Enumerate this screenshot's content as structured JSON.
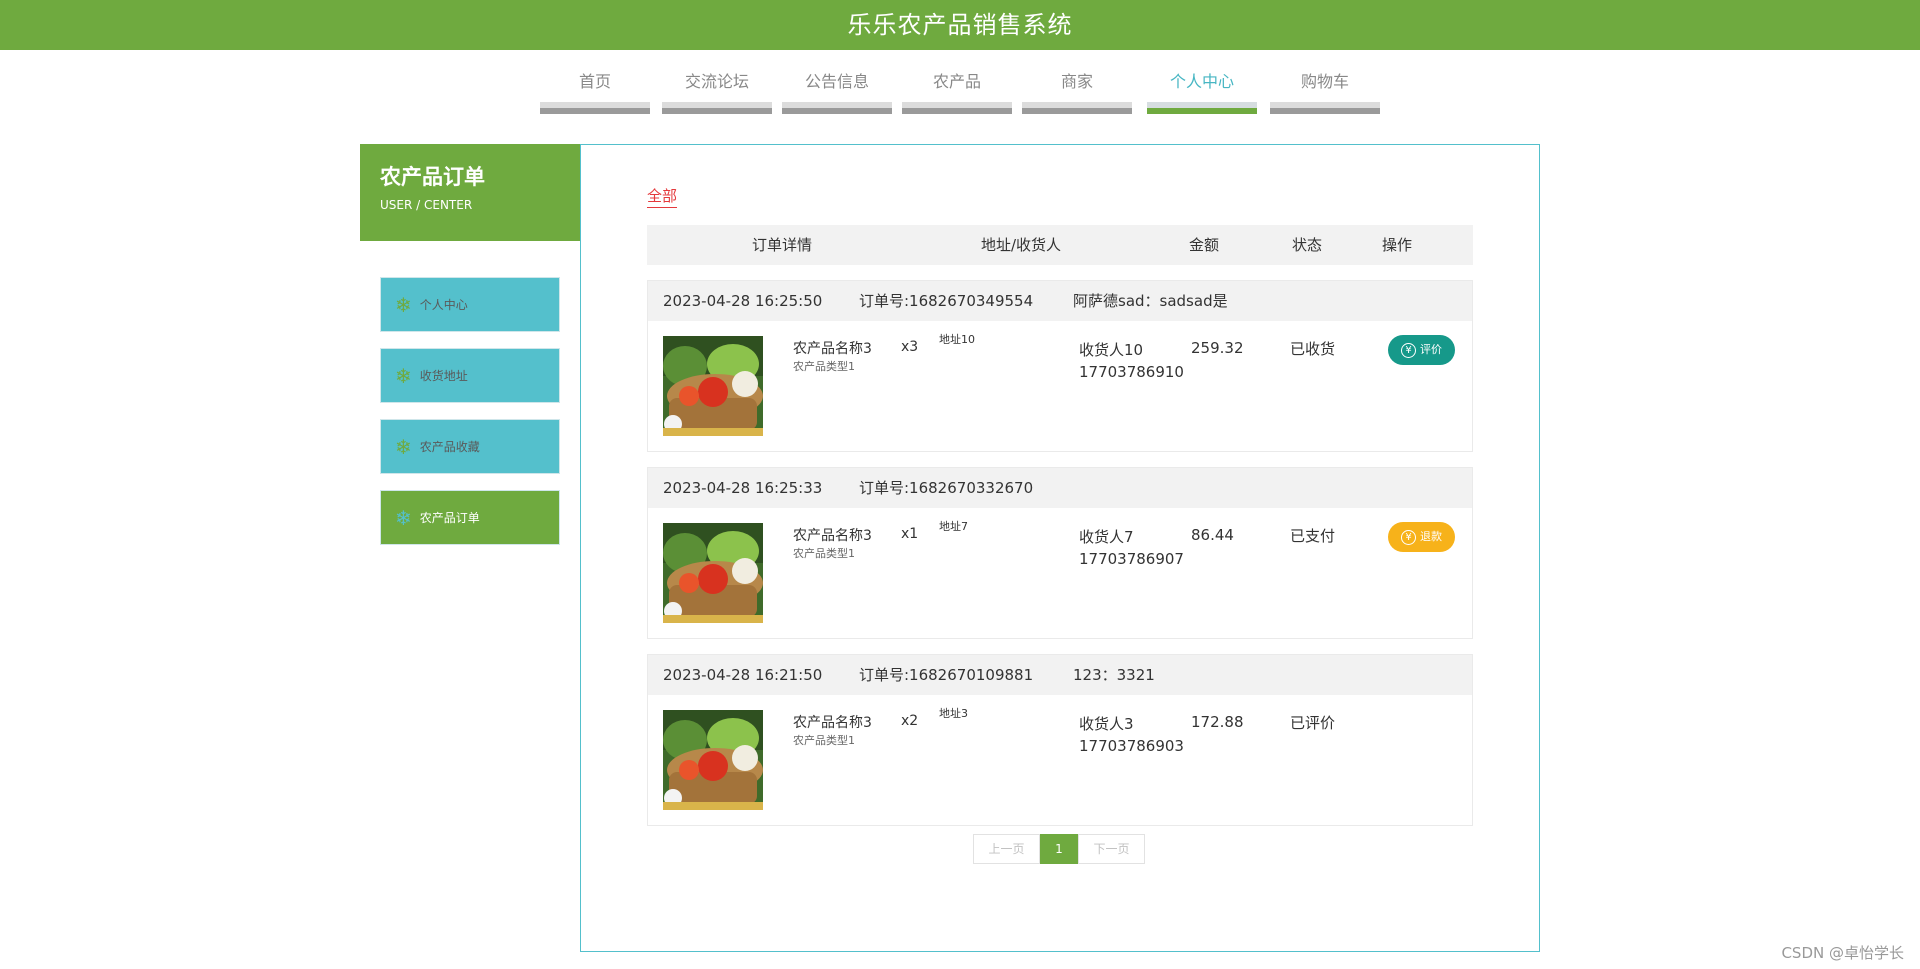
{
  "app": {
    "title": "乐乐农产品销售系统"
  },
  "nav": {
    "items": [
      {
        "label": "首页"
      },
      {
        "label": "交流论坛"
      },
      {
        "label": "公告信息"
      },
      {
        "label": "农产品"
      },
      {
        "label": "商家"
      },
      {
        "label": "个人中心",
        "active": true
      },
      {
        "label": "购物车"
      }
    ]
  },
  "sidebar": {
    "title": "农产品订单",
    "subtitle": "USER / CENTER",
    "items": [
      {
        "label": "个人中心",
        "icon": "snowflake-icon"
      },
      {
        "label": "收货地址",
        "icon": "snowflake-icon"
      },
      {
        "label": "农产品收藏",
        "icon": "snowflake-icon"
      },
      {
        "label": "农产品订单",
        "icon": "snowflake-icon",
        "active": true
      }
    ]
  },
  "main": {
    "filter_tab": "全部",
    "table_headers": {
      "details": "订单详情",
      "address": "地址/收货人",
      "amount": "金额",
      "status": "状态",
      "action": "操作"
    },
    "orders": [
      {
        "time": "2023-04-28 16:25:50",
        "order_no": "订单号:1682670349554",
        "note": "阿萨德sad：sadsad是",
        "product_name": "农产品名称3",
        "product_type": "农产品类型1",
        "quantity": "x3",
        "address": "地址10",
        "receiver": "收货人10",
        "phone": "17703786910",
        "amount": "259.32",
        "status": "已收货",
        "action": "评价"
      },
      {
        "time": "2023-04-28 16:25:33",
        "order_no": "订单号:1682670332670",
        "note": "",
        "product_name": "农产品名称3",
        "product_type": "农产品类型1",
        "quantity": "x1",
        "address": "地址7",
        "receiver": "收货人7",
        "phone": "17703786907",
        "amount": "86.44",
        "status": "已支付",
        "action": "退款"
      },
      {
        "time": "2023-04-28 16:21:50",
        "order_no": "订单号:1682670109881",
        "note": "123：3321",
        "product_name": "农产品名称3",
        "product_type": "农产品类型1",
        "quantity": "x2",
        "address": "地址3",
        "receiver": "收货人3",
        "phone": "17703786903",
        "amount": "172.88",
        "status": "已评价",
        "action": ""
      }
    ],
    "pagination": {
      "prev": "上一页",
      "current": "1",
      "next": "下一页"
    }
  },
  "watermark": "CSDN @卓怡学长",
  "colors": {
    "brand_green": "#6faa3f",
    "teal": "#54c0cc",
    "review_button": "#16998a",
    "refund_button": "#f7b21a",
    "filter_red": "#e4393c"
  }
}
